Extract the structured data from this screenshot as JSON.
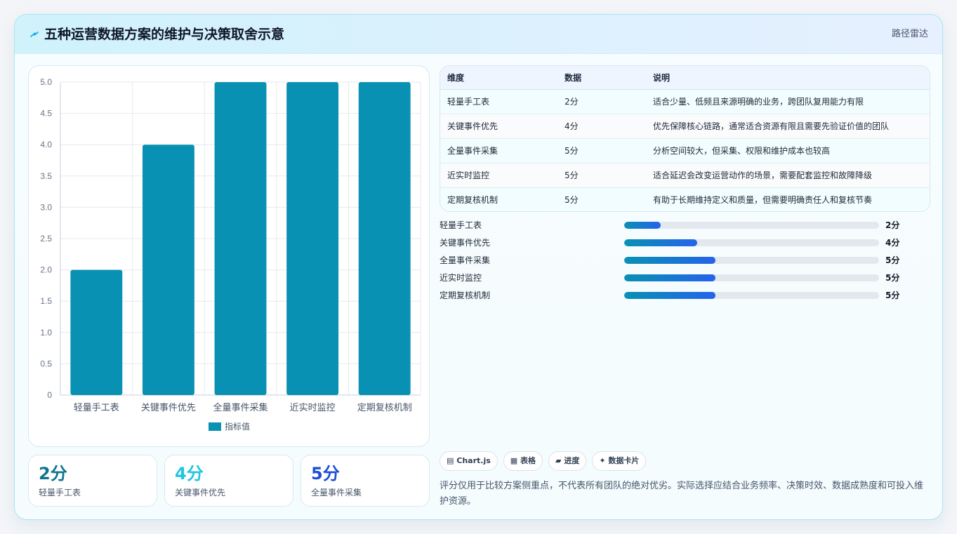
{
  "header": {
    "icon": "lightning-icon",
    "title": "五种运营数据方案的维护与决策取舍示意",
    "badge": "路径雷达"
  },
  "chart_data": {
    "type": "bar",
    "categories": [
      "轻量手工表",
      "关键事件优先",
      "全量事件采集",
      "近实时监控",
      "定期复核机制"
    ],
    "series": [
      {
        "name": "指标值",
        "values": [
          2,
          4,
          5,
          5,
          5
        ],
        "color": "#0891b2"
      }
    ],
    "ylim": [
      0,
      5
    ],
    "yticks": [
      "0",
      "0.5",
      "1.0",
      "1.5",
      "2.0",
      "2.5",
      "3.0",
      "3.5",
      "4.0",
      "4.5",
      "5.0"
    ],
    "grid": true,
    "legend": "bottom"
  },
  "kpis": [
    {
      "value": "2分",
      "label": "轻量手工表",
      "color": "#0e7490"
    },
    {
      "value": "4分",
      "label": "关键事件优先",
      "color": "#22c5e0"
    },
    {
      "value": "5分",
      "label": "全量事件采集",
      "color": "#1d4ed8"
    }
  ],
  "table": {
    "headers": [
      "维度",
      "数据",
      "说明"
    ],
    "rows": [
      [
        "轻量手工表",
        "2分",
        "适合少量、低频且来源明确的业务，跨团队复用能力有限"
      ],
      [
        "关键事件优先",
        "4分",
        "优先保障核心链路，通常适合资源有限且需要先验证价值的团队"
      ],
      [
        "全量事件采集",
        "5分",
        "分析空间较大，但采集、权限和维护成本也较高"
      ],
      [
        "近实时监控",
        "5分",
        "适合延迟会改变运营动作的场景，需要配套监控和故障降级"
      ],
      [
        "定期复核机制",
        "5分",
        "有助于长期维持定义和质量，但需要明确责任人和复核节奏"
      ]
    ]
  },
  "progress": {
    "max": 14,
    "items": [
      {
        "label": "轻量手工表",
        "value": 2,
        "text": "2分"
      },
      {
        "label": "关键事件优先",
        "value": 4,
        "text": "4分"
      },
      {
        "label": "全量事件采集",
        "value": 5,
        "text": "5分"
      },
      {
        "label": "近实时监控",
        "value": 5,
        "text": "5分"
      },
      {
        "label": "定期复核机制",
        "value": 5,
        "text": "5分"
      }
    ]
  },
  "tags": [
    {
      "icon": "chart-icon",
      "glyph": "▤",
      "label": "Chart.js"
    },
    {
      "icon": "table-icon",
      "glyph": "▦",
      "label": "表格"
    },
    {
      "icon": "progress-icon",
      "glyph": "▰",
      "label": "进度"
    },
    {
      "icon": "sparkle-icon",
      "glyph": "✦",
      "label": "数据卡片"
    }
  ],
  "note": "评分仅用于比较方案侧重点，不代表所有团队的绝对优劣。实际选择应结合业务频率、决策时效、数据成熟度和可投入维护资源。"
}
